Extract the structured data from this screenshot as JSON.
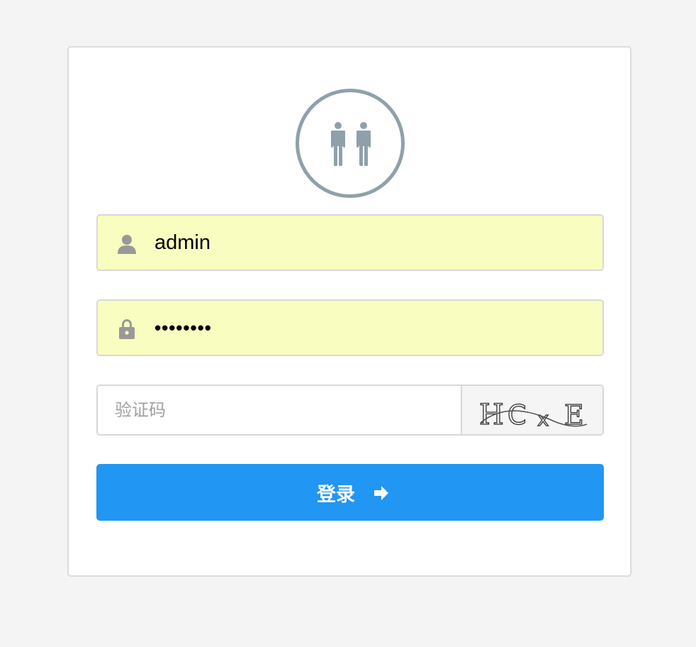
{
  "login_form": {
    "username": {
      "value": "admin",
      "icon": "user-icon"
    },
    "password": {
      "value": "********",
      "icon": "lock-icon"
    },
    "captcha": {
      "placeholder": "验证码",
      "image_text": "HCxE"
    },
    "submit": {
      "label": "登录",
      "icon": "arrow-right-icon"
    }
  },
  "colors": {
    "page_background": "#f4f4f4",
    "card_background": "#ffffff",
    "autofill_background": "#fafdc0",
    "avatar_stroke": "#8ea1ab",
    "icon_gray": "#999999",
    "button_blue": "#2196f3"
  },
  "avatar_icon": "users-icon"
}
